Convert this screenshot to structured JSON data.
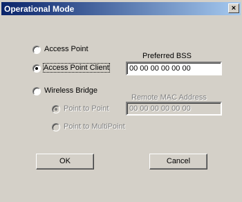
{
  "window": {
    "title": "Operational Mode",
    "close_glyph": "×"
  },
  "modes": {
    "access_point": {
      "label": "Access Point",
      "selected": false
    },
    "access_point_client": {
      "label": "Access Point Client",
      "selected": true
    },
    "wireless_bridge": {
      "label": "Wireless Bridge",
      "selected": false
    }
  },
  "preferred_bss": {
    "label": "Preferred BSS",
    "value": "00 00 00 00 00 00"
  },
  "remote_mac": {
    "label": "Remote MAC Address",
    "value": "00 00 00 00 00 00"
  },
  "bridge_modes": {
    "point_to_point": {
      "label": "Point to Point",
      "selected": true
    },
    "point_to_multipoint": {
      "label": "Point to MultiPoint",
      "selected": false
    }
  },
  "buttons": {
    "ok": "OK",
    "cancel": "Cancel"
  }
}
